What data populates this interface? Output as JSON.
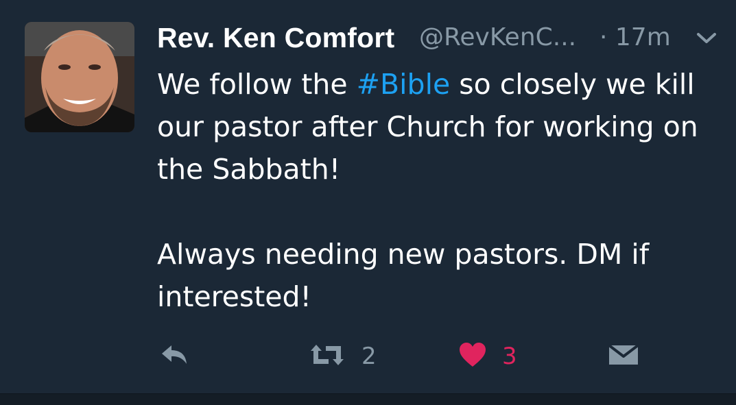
{
  "tweet": {
    "author_name": "Rev. Ken Comfort",
    "handle": "@RevKenC...",
    "time": "· 17m",
    "text_before_hashtag": "We follow the ",
    "hashtag": "#Bible",
    "text_after_hashtag": " so closely we kill our pastor after Church for working on the Sabbath!",
    "paragraph_2": "Always needing new pastors. DM if interested!",
    "retweet_count": "2",
    "like_count": "3"
  },
  "colors": {
    "background": "#1b2836",
    "hashtag": "#1da1f2",
    "muted": "#8899a6",
    "like": "#e0245e"
  },
  "icons": {
    "caret": "chevron-down-icon",
    "reply": "reply-icon",
    "retweet": "retweet-icon",
    "like": "heart-icon",
    "dm": "envelope-icon"
  }
}
